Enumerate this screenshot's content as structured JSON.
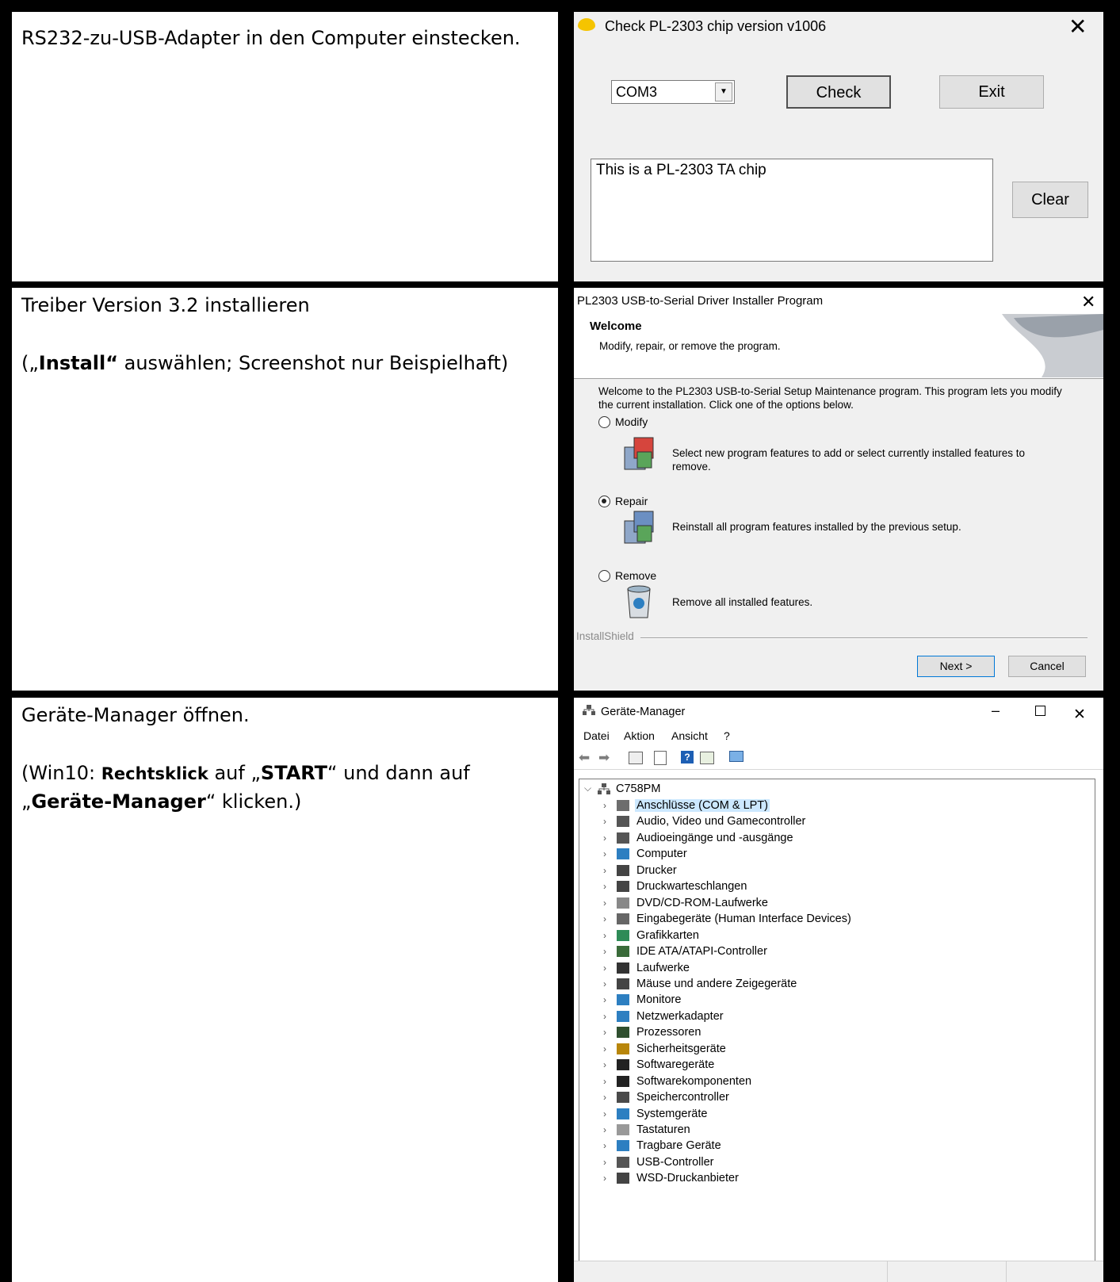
{
  "rows": [
    {
      "left": {
        "line1": "RS232-zu-USB-Adapter in den Computer einstecken."
      },
      "window": {
        "title": "Check PL-2303 chip version v1006",
        "com_port": "COM3",
        "check_label": "Check",
        "exit_label": "Exit",
        "output_text": "This is a PL-2303 TA chip",
        "clear_label": "Clear"
      }
    },
    {
      "left": {
        "line1": "Treiber Version 3.2 installieren",
        "line2_prefix": "(„",
        "line2_bold": "Install“",
        "line2_suffix": " auswählen; Screenshot nur Beispielhaft)"
      },
      "window": {
        "title": "PL2303 USB-to-Serial Driver Installer Program",
        "heading": "Welcome",
        "subheading": "Modify, repair, or remove the program.",
        "intro": "Welcome to the PL2303 USB-to-Serial Setup Maintenance program. This program lets you modify the current installation. Click one of the options below.",
        "options": [
          {
            "label": "Modify",
            "desc": "Select new program features to add or select currently installed features to remove.",
            "selected": "false"
          },
          {
            "label": "Repair",
            "desc": "Reinstall all program features installed by the previous setup.",
            "selected": "true"
          },
          {
            "label": "Remove",
            "desc": "Remove all installed features.",
            "selected": "false"
          }
        ],
        "brand": "InstallShield",
        "next_label": "Next >",
        "cancel_label": "Cancel"
      }
    },
    {
      "left": {
        "line1": "Geräte-Manager öffnen.",
        "p_open": "(Win10: ",
        "b1": "Rechtsklick",
        "t1": " auf „",
        "b2": "START",
        "t2": "“ und dann auf „",
        "b3": "Geräte-Manager",
        "t3": "“ klicken.)"
      },
      "window": {
        "title": "Geräte-Manager",
        "menu": [
          "Datei",
          "Aktion",
          "Ansicht",
          "?"
        ],
        "root": "C758PM",
        "items": [
          "Anschlüsse (COM & LPT)",
          "Audio, Video und Gamecontroller",
          "Audioeingänge und -ausgänge",
          "Computer",
          "Drucker",
          "Druckwarteschlangen",
          "DVD/CD-ROM-Laufwerke",
          "Eingabegeräte (Human Interface Devices)",
          "Grafikkarten",
          "IDE ATA/ATAPI-Controller",
          "Laufwerke",
          "Mäuse und andere Zeigegeräte",
          "Monitore",
          "Netzwerkadapter",
          "Prozessoren",
          "Sicherheitsgeräte",
          "Softwaregeräte",
          "Softwarekomponenten",
          "Speichercontroller",
          "Systemgeräte",
          "Tastaturen",
          "Tragbare Geräte",
          "USB-Controller",
          "WSD-Druckanbieter"
        ]
      }
    }
  ]
}
